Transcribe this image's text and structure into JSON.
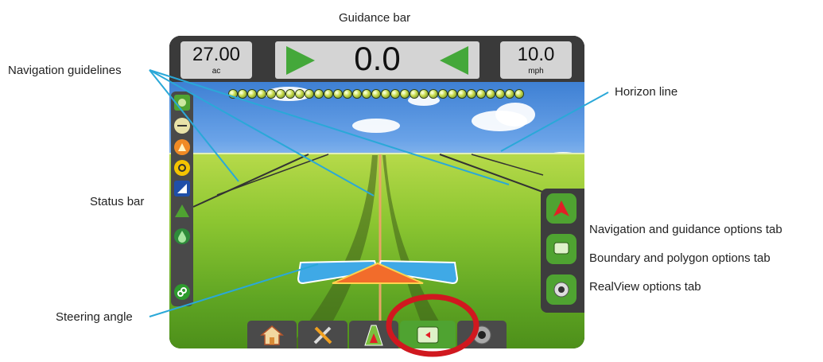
{
  "callouts": {
    "guidance_bar": "Guidance bar",
    "navigation_guidelines": "Navigation guidelines",
    "horizon_line": "Horizon line",
    "status_bar": "Status bar",
    "nav_guidance_tab": "Navigation and guidance options tab",
    "boundary_polygon_tab": "Boundary and polygon options tab",
    "realview_tab": "RealView options tab",
    "steering_angle": "Steering angle"
  },
  "guidance_bar": {
    "area_value": "27.00",
    "area_unit": "ac",
    "cross_track": "0.0",
    "speed_value": "10.0",
    "speed_unit": "mph"
  },
  "lightbar": {
    "led_count": 31
  },
  "status_icons": [
    "gps-status-icon",
    "guidance-mode-icon",
    "tilt-correction-icon",
    "auto-steering-icon",
    "boomsection-icon",
    "bsu-status-icon",
    "tube-icon",
    "connection-icon"
  ],
  "right_tabs": [
    "navigation-guidance-options",
    "boundary-polygon-options",
    "realview-options"
  ],
  "bottom_tabs": [
    "home",
    "system-setup",
    "vehicle-view",
    "guidance-view",
    "realview"
  ],
  "colors": {
    "accent_green": "#4fa331",
    "accent_red": "#e21f26",
    "steering_blue": "#3fa9e6",
    "steering_orange": "#f26c2b",
    "callout_line": "#2aa8d8"
  }
}
